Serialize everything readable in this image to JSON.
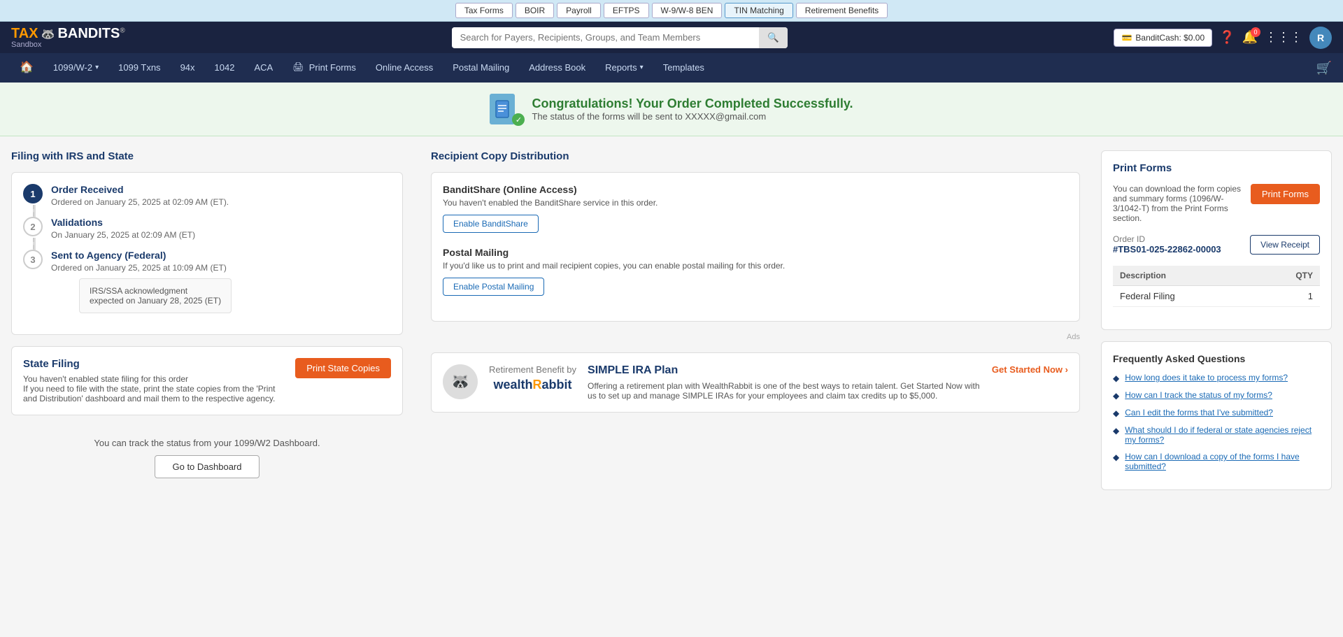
{
  "topTabs": {
    "items": [
      {
        "label": "Tax Forms",
        "active": false
      },
      {
        "label": "BOIR",
        "active": false
      },
      {
        "label": "Payroll",
        "active": false
      },
      {
        "label": "EFTPS",
        "active": false
      },
      {
        "label": "W-9/W-8 BEN",
        "active": false
      },
      {
        "label": "TIN Matching",
        "active": true
      },
      {
        "label": "Retirement Benefits",
        "active": false
      }
    ]
  },
  "header": {
    "logo": "TAX🦝BANDITS",
    "sandbox": "Sandbox",
    "search_placeholder": "Search for Payers, Recipients, Groups, and Team Members",
    "bandit_cash": "BanditCash: $0.00"
  },
  "mainNav": {
    "home": "🏠",
    "items": [
      {
        "label": "1099/W-2",
        "dropdown": true
      },
      {
        "label": "1099 Txns"
      },
      {
        "label": "94x"
      },
      {
        "label": "1042"
      },
      {
        "label": "ACA"
      },
      {
        "label": "Print Forms",
        "icon": "🖨"
      },
      {
        "label": "Online Access"
      },
      {
        "label": "Postal Mailing"
      },
      {
        "label": "Address Book"
      },
      {
        "label": "Reports",
        "dropdown": true
      },
      {
        "label": "Templates"
      }
    ]
  },
  "successBanner": {
    "title": "Congratulations! Your Order Completed Successfully.",
    "subtitle": "The status of the forms will be sent to XXXXX@gmail.com"
  },
  "filingSection": {
    "title": "Filing with IRS and State",
    "steps": [
      {
        "number": "1",
        "filled": true,
        "title": "Order Received",
        "description": "Ordered on January 25, 2025 at 02:09 AM (ET)."
      },
      {
        "number": "2",
        "filled": false,
        "title": "Validations",
        "description": "On January 25, 2025 at 02:09 AM (ET)"
      },
      {
        "number": "3",
        "filled": false,
        "title": "Sent to Agency (Federal)",
        "description": "Ordered on January 25, 2025 at 10:09 AM (ET)"
      }
    ],
    "irs_ack": {
      "line1": "IRS/SSA acknowledgment",
      "line2": "expected on January 28, 2025 (ET)"
    }
  },
  "stateFiling": {
    "title": "State Filing",
    "description1": "You haven't enabled state filing for this order",
    "description2": "If you need to file with the state, print the state copies from the 'Print and Distribution' dashboard and mail them to the respective agency.",
    "button": "Print State Copies"
  },
  "dashboardSection": {
    "text": "You can track the status from your 1099/W2 Dashboard.",
    "button": "Go to Dashboard"
  },
  "recipientSection": {
    "title": "Recipient Copy Distribution",
    "banditShare": {
      "title": "BanditShare (Online Access)",
      "description": "You haven't enabled the BanditShare service in this order.",
      "button": "Enable BanditShare"
    },
    "postalMailing": {
      "title": "Postal Mailing",
      "description": "If you'd like us to print and mail recipient copies, you can enable postal mailing for this order.",
      "button": "Enable Postal Mailing"
    }
  },
  "printFormsSection": {
    "title": "Print Forms",
    "description": "You can download the form copies and summary forms (1096/W-3/1042-T) from the Print Forms section.",
    "button": "Print Forms",
    "orderId": {
      "label": "Order ID",
      "value": "#TBS01-025-22862-00003",
      "button": "View Receipt"
    },
    "table": {
      "headers": [
        "Description",
        "QTY"
      ],
      "rows": [
        {
          "description": "Federal Filing",
          "qty": "1"
        }
      ]
    }
  },
  "faq": {
    "title": "Frequently Asked Questions",
    "items": [
      {
        "question": "How long does it take to process my forms?"
      },
      {
        "question": "How can I track the status of my forms?"
      },
      {
        "question": "Can I edit the forms that I've submitted?"
      },
      {
        "question": "What should I do if federal or state agencies reject my forms?"
      },
      {
        "question": "How can I download a copy of the forms I have submitted?"
      }
    ]
  },
  "ads": {
    "label": "Ads",
    "logoText": "Retirement Benefit by",
    "brandName": "wealthRabbit",
    "adTitle": "SIMPLE IRA Plan",
    "adBody": "Offering a retirement plan with WealthRabbit is one of the best ways to retain talent. Get Started Now with us to set up and manage SIMPLE IRAs for your employees and claim tax credits up to $5,000.",
    "cta": "Get Started Now ›"
  }
}
